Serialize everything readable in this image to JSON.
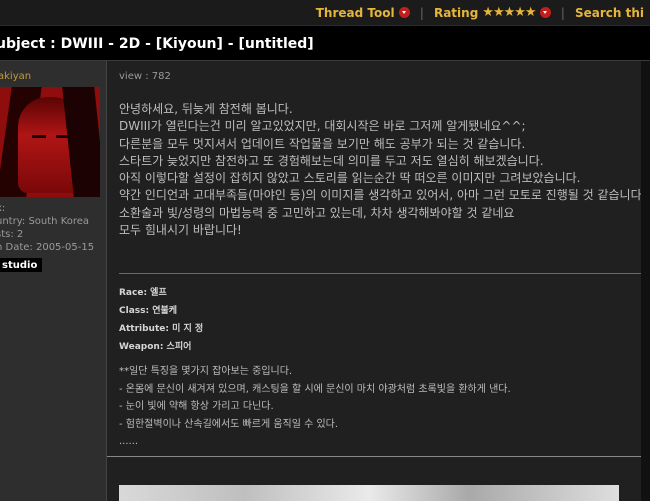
{
  "topbar": {
    "thread_tool": "Thread Tool",
    "rating_label": "Rating",
    "rating_stars": 5,
    "search": "Search thi"
  },
  "subject": "ubject : DWIII - 2D - [Kiyoun] - [untitled]",
  "user": {
    "name": "akiyan",
    "meta1": "x:",
    "country": "untry: South Korea",
    "posts": "sts: 2",
    "join": "n Date: 2005-05-15",
    "badge": "studio"
  },
  "post": {
    "views": "view : 782",
    "lines": [
      "안녕하세요, 뒤늦게 참전해 봅니다.",
      "DWIII가 열린다는건 미리 알고있었지만, 대회시작은 바로 그저께 알게됐네요^^;",
      "다른분을 모두 멋지셔서 업데이트 작업물을 보기만 해도 공부가 되는 것 같습니다.",
      "스타트가 늦었지만 참전하고 또 경험해보는데 의미를 두고 저도 열심히 해보겠습니다.",
      "아직 이렇다할 설정이 잡히지 않았고 스토리를 읽는순간 딱 떠오른 이미지만 그려보았습니다.",
      "약간 인디언과 고대부족들(마야인 등)의 이미지를 생각하고 있어서, 아마 그런 모토로 진행될 것 같습니다.",
      "소환술과 빛/성령의 마법능력 중 고민하고 있는데, 차차 생각해봐야할 것 같네요",
      "모두 힘내시기 바랍니다!"
    ],
    "race": "Race: 엘프",
    "class": "Class: 연불케",
    "attribute": "Attribute: 미 지 정",
    "weapon": "Weapon: 스피어",
    "notes": [
      "**일단 특징을 몇가지 잡아보는 중입니다.",
      "- 온몸에 문신이 새겨져 있으며, 캐스팅을 할 시에 문신이 마치 야광처럼 초록빛을 환하게 낸다.",
      "- 눈이 빛에 약해 항상 가리고 다닌다.",
      "- 험한절벽이나 산속길에서도 빠르게 움직일 수 있다.",
      "......"
    ]
  },
  "colors": {
    "accent": "#e7b53c",
    "dropdown": "#c21e1e"
  }
}
